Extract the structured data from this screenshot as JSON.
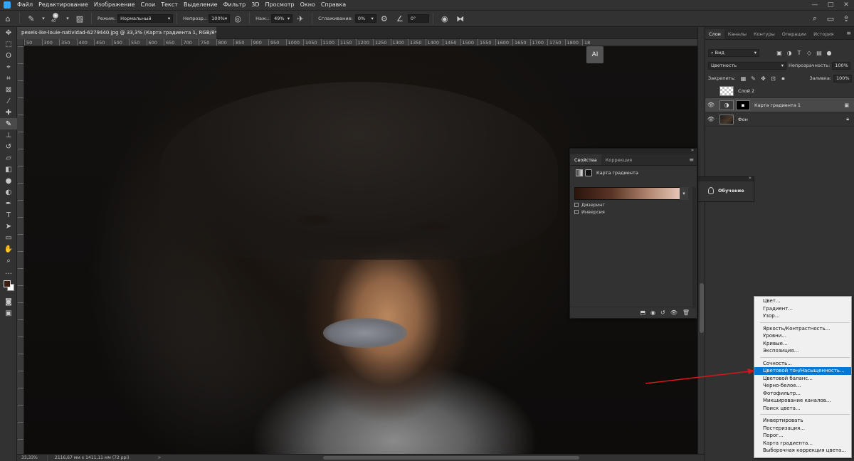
{
  "menubar": {
    "items": [
      "Файл",
      "Редактирование",
      "Изображение",
      "Слои",
      "Текст",
      "Выделение",
      "Фильтр",
      "3D",
      "Просмотр",
      "Окно",
      "Справка"
    ],
    "window_controls": [
      "—",
      "□",
      "✕"
    ]
  },
  "options": {
    "brush_size": "40",
    "mode_label": "Режим:",
    "mode_value": "Нормальный",
    "opacity_label": "Непрозр.:",
    "opacity_value": "100%",
    "pressure_label": "Наж.:",
    "pressure_value": "49%",
    "smoothing_label": "Сглаживание:",
    "smoothing_value": "0%",
    "angle_value": "0°"
  },
  "document": {
    "tab_title": "pexels-ike-louie-natividad-6279440.jpg @ 33,3% (Карта градиента 1, RGB/8*) *",
    "close": "✕",
    "ruler_h": [
      "50",
      "300",
      "350",
      "400",
      "450",
      "500",
      "550",
      "600",
      "650",
      "700",
      "750",
      "800",
      "850",
      "900",
      "950",
      "1000",
      "1050",
      "1100",
      "1150",
      "1200",
      "1250",
      "1300",
      "1350",
      "1400",
      "1450",
      "1500",
      "1550",
      "1600",
      "1650",
      "1700",
      "1750",
      "1800",
      "18"
    ],
    "canvas_button": "AI"
  },
  "layers_panel": {
    "tabs": [
      "Слои",
      "Каналы",
      "Контуры",
      "Операции",
      "История"
    ],
    "filter_value": "Вид",
    "blend_mode": "Цветность",
    "opacity_label": "Непрозрачность:",
    "opacity_value": "100%",
    "lock_label": "Закрепить:",
    "fill_label": "Заливка:",
    "fill_value": "100%",
    "layers": [
      {
        "name": "Слой 2",
        "visible": false
      },
      {
        "name": "Карта градиента 1",
        "visible": true,
        "selected": true
      },
      {
        "name": "Фон",
        "visible": true,
        "locked": true
      }
    ]
  },
  "properties_panel": {
    "tabs": [
      "Свойства",
      "Коррекция"
    ],
    "header": "Карта градиента",
    "checkbox_dither": "Дизеринг",
    "checkbox_reverse": "Инверсия",
    "gradient_colors": [
      "#2b140c",
      "#5b3526",
      "#b48a74",
      "#f2d6c8"
    ]
  },
  "learn_panel": {
    "label": "Обучение"
  },
  "statusbar": {
    "zoom": "33,33%",
    "info": "2116,67 мм х 1411,11 мм (72 ppi)",
    "arrow": ">"
  },
  "context_menu": {
    "groups": [
      [
        "Цвет...",
        "Градиент...",
        "Узор..."
      ],
      [
        "Яркость/Контрастность...",
        "Уровни...",
        "Кривые...",
        "Экспозиция..."
      ],
      [
        "Сочность...",
        "Цветовой тон/Насыщенность...",
        "Цветовой баланс...",
        "Черно-белое...",
        "Фотофильтр...",
        "Микширование каналов...",
        "Поиск цвета..."
      ],
      [
        "Инвертировать",
        "Постеризация...",
        "Порог...",
        "Карта градиента...",
        "Выборочная коррекция цвета..."
      ]
    ],
    "highlighted": "Цветовой тон/Насыщенность..."
  },
  "colors": {
    "foreground": "#3b1d10",
    "background": "#ffffff",
    "highlight": "#0078d7",
    "arrow": "#d01818"
  }
}
